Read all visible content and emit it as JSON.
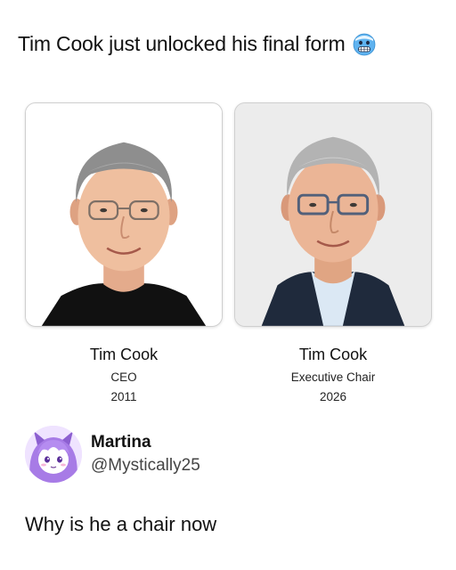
{
  "post": {
    "caption": "Tim Cook just unlocked his final form",
    "caption_emoji": "cold-face-emoji"
  },
  "cards": [
    {
      "name": "Tim Cook",
      "role": "CEO",
      "year": "2011",
      "background": "#ffffff",
      "shirt": "#111111"
    },
    {
      "name": "Tim Cook",
      "role": "Executive Chair",
      "year": "2026",
      "background": "#ececec",
      "shirt": "#1f2a3c"
    }
  ],
  "reply": {
    "display_name": "Martina",
    "handle": "@Mystically25",
    "text": "Why is he a chair now",
    "avatar_color": "#a77be6"
  }
}
